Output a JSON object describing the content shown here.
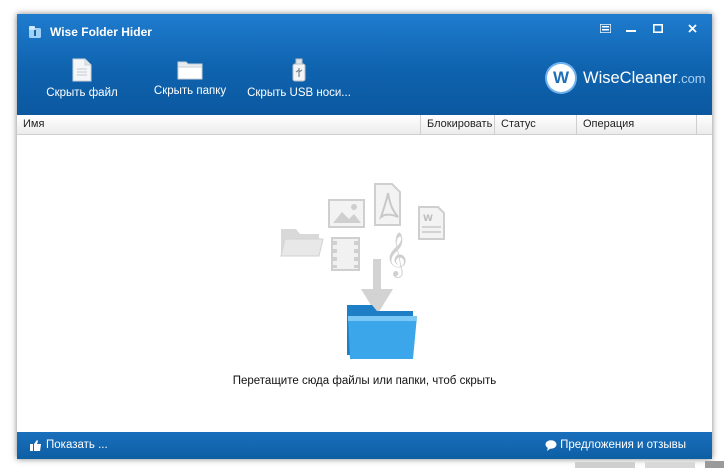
{
  "window": {
    "title": "Wise Folder Hider"
  },
  "toolbar": {
    "hide_file": "Скрыть файл",
    "hide_folder": "Скрыть папку",
    "hide_usb": "Скрыть USB носи..."
  },
  "brand": {
    "name": "WiseCleaner",
    "domain": ".com",
    "logo_letter": "W"
  },
  "columns": {
    "name": "Имя",
    "lock": "Блокировать",
    "status": "Статус",
    "operation": "Операция"
  },
  "content": {
    "drop_hint": "Перетащите сюда файлы или папки, чтоб скрыть"
  },
  "footer": {
    "show": "Показать ...",
    "feedback": "Предложения и отзывы"
  },
  "colors": {
    "header": "#1a72c2",
    "frame": "#0d5fa3",
    "folder": "#2f9fe0"
  }
}
